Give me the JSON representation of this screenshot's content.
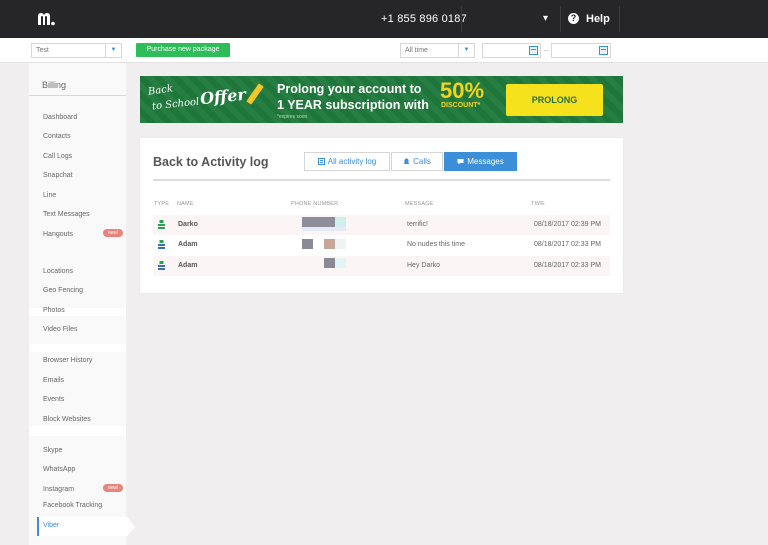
{
  "topbar": {
    "phone": "+1 855 896 0187",
    "help_label": "Help",
    "help_icon": "question-icon"
  },
  "filter": {
    "device_value": "Test",
    "purchase_label": "Purchase new package",
    "time_value": "All time",
    "date_separator": "--"
  },
  "sidebar": {
    "heading": "Billing",
    "items": [
      {
        "label": "Dashboard"
      },
      {
        "label": "Contacts"
      },
      {
        "label": "Call Logs"
      },
      {
        "label": "Snapchat"
      },
      {
        "label": "Line"
      },
      {
        "label": "Text Messages"
      },
      {
        "label": "Hangouts",
        "badge": "new!"
      },
      {
        "label": "Locations"
      },
      {
        "label": "Geo Fencing"
      },
      {
        "label": "Photos"
      },
      {
        "label": "Video Files"
      },
      {
        "label": "Browser History"
      },
      {
        "label": "Emails"
      },
      {
        "label": "Events"
      },
      {
        "label": "Block Websites"
      },
      {
        "label": "Skype"
      },
      {
        "label": "WhatsApp"
      },
      {
        "label": "Instagram",
        "badge": "new!"
      },
      {
        "label": "Facebook Tracking"
      },
      {
        "label": "Viber",
        "active": true
      }
    ]
  },
  "banner": {
    "word1": "Back",
    "word2": "to School",
    "word3": "Offer",
    "line1": "Prolong your account to",
    "line2": "1 YEAR subscription with",
    "percent": "50%",
    "discount": "DISCOUNT*",
    "expires": "*expires soon",
    "cta": "PROLONG",
    "bg_color": "#1f7a3c",
    "accent_color": "#f6d21b"
  },
  "activity": {
    "title": "Back to Activity log",
    "tabs": [
      {
        "label": "All activity log",
        "icon": "list-icon"
      },
      {
        "label": "Calls",
        "icon": "bell-icon"
      },
      {
        "label": "Messages",
        "icon": "message-icon",
        "active": true
      }
    ],
    "columns": {
      "type": "TYPE",
      "name": "NAME",
      "phone": "PHONE NUMBER",
      "message": "MESSAGE",
      "time": "TIME"
    },
    "rows": [
      {
        "name": "Darko",
        "message": "terrific!",
        "time": "08/18/2017 02:39 PM"
      },
      {
        "name": "Adam",
        "message": "No nudes this time",
        "time": "08/18/2017 02:33 PM"
      },
      {
        "name": "Adam",
        "message": "Hey Darko",
        "time": "08/18/2017 02:33 PM"
      }
    ]
  }
}
